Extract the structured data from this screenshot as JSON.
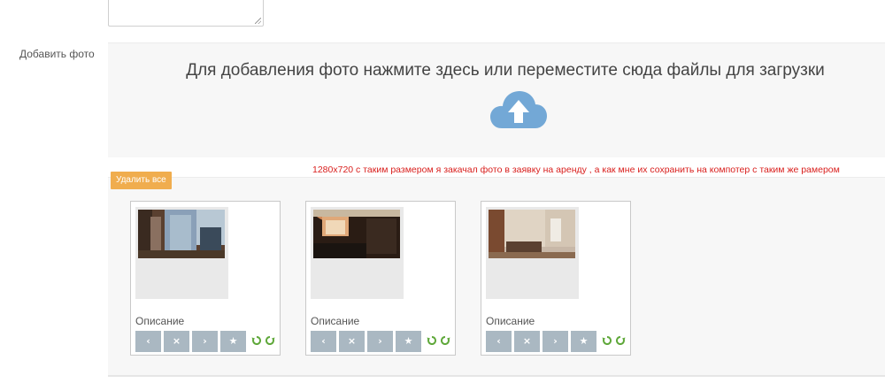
{
  "form": {
    "add_photo_label": "Добавить фото"
  },
  "dropzone": {
    "text": "Для добавления фото нажмите здесь или переместите сюда файлы для загрузки",
    "icon": "cloud-upload-icon",
    "icon_color": "#73a8d6"
  },
  "gallery": {
    "delete_all_label": "Удалить все",
    "annotation": "1280х720 с таким размером я закачал фото в заявку на аренду , а как мне их сохранить на компотер с таким же рамером",
    "annotation_color": "#d9201e",
    "photos": [
      {
        "description": "Описание"
      },
      {
        "description": "Описание"
      },
      {
        "description": "Описание"
      }
    ],
    "actions": {
      "prev_glyph": "‹",
      "delete_glyph": "×",
      "next_glyph": "›",
      "main_glyph": "★",
      "rotate_left_icon": "rotate-left-icon",
      "rotate_right_icon": "rotate-right-icon",
      "button_color": "#aab8c2",
      "rotate_color": "#5fa83a"
    }
  }
}
